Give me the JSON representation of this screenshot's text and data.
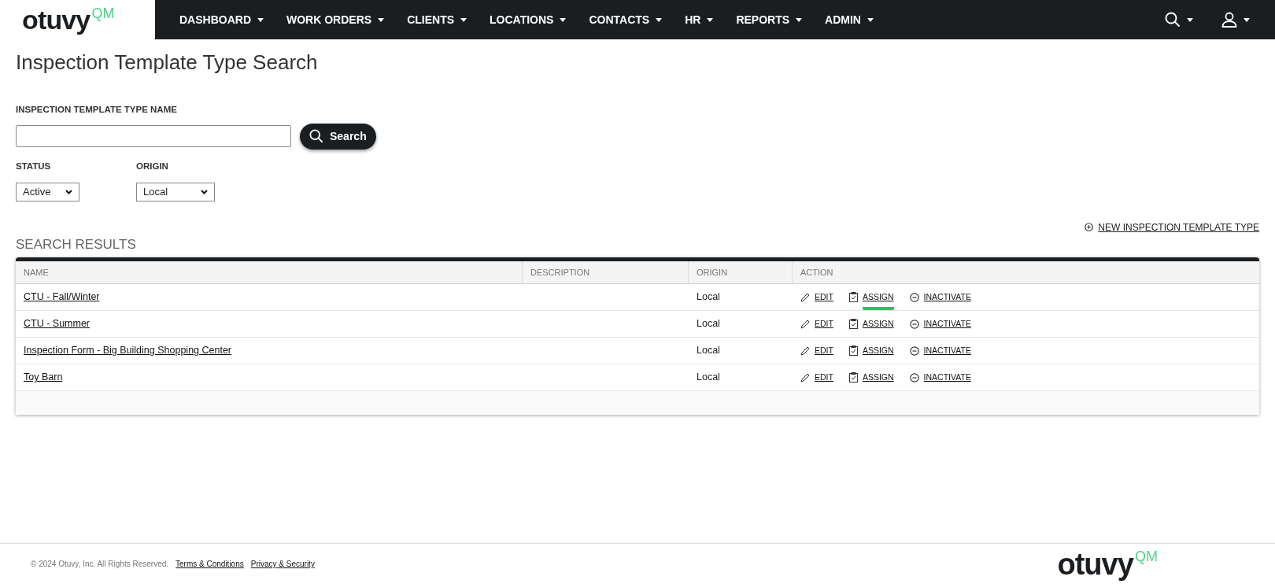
{
  "header": {
    "logo": {
      "text": "otuvy",
      "suffix": "QM"
    },
    "nav": [
      {
        "label": "DASHBOARD"
      },
      {
        "label": "WORK ORDERS"
      },
      {
        "label": "CLIENTS"
      },
      {
        "label": "LOCATIONS"
      },
      {
        "label": "CONTACTS"
      },
      {
        "label": "HR"
      },
      {
        "label": "REPORTS"
      },
      {
        "label": "ADMIN"
      }
    ]
  },
  "page_title": "Inspection Template Type Search",
  "filters": {
    "name_label": "INSPECTION TEMPLATE TYPE NAME",
    "search_button": "Search",
    "status": {
      "label": "STATUS",
      "value": "Active"
    },
    "origin": {
      "label": "ORIGIN",
      "value": "Local"
    }
  },
  "new_link": "NEW INSPECTION TEMPLATE TYPE",
  "results_title": "SEARCH RESULTS",
  "table": {
    "columns": [
      "NAME",
      "DESCRIPTION",
      "ORIGIN",
      "ACTION"
    ],
    "rows": [
      {
        "name": "CTU - Fall/Winter",
        "origin": "Local",
        "actions": [
          {
            "kind": "edit",
            "label": "EDIT",
            "highlighted": false
          },
          {
            "kind": "assign",
            "label": "ASSIGN",
            "highlighted": true
          },
          {
            "kind": "inactivate",
            "label": "INACTIVATE",
            "highlighted": false
          }
        ]
      },
      {
        "name": "CTU - Summer",
        "origin": "Local",
        "actions": [
          {
            "kind": "edit",
            "label": "EDIT",
            "highlighted": false
          },
          {
            "kind": "assign",
            "label": "ASSIGN",
            "highlighted": false
          },
          {
            "kind": "inactivate",
            "label": "INACTIVATE",
            "highlighted": false
          }
        ]
      },
      {
        "name": "Inspection Form - Big Building Shopping Center",
        "origin": "Local",
        "actions": [
          {
            "kind": "edit",
            "label": "EDIT",
            "highlighted": false
          },
          {
            "kind": "assign",
            "label": "ASSIGN",
            "highlighted": false
          },
          {
            "kind": "inactivate",
            "label": "INACTIVATE",
            "highlighted": false
          }
        ]
      },
      {
        "name": "Toy Barn",
        "origin": "Local",
        "actions": [
          {
            "kind": "edit",
            "label": "EDIT",
            "highlighted": false
          },
          {
            "kind": "assign",
            "label": "ASSIGN",
            "highlighted": false
          },
          {
            "kind": "inactivate",
            "label": "INACTIVATE",
            "highlighted": false
          }
        ]
      }
    ]
  },
  "footer": {
    "copyright": "© 2024 Otuvy, Inc. All Rights Reserved.",
    "links": [
      "Terms & Conditions",
      "Privacy & Security"
    ],
    "logo": {
      "text": "otuvy",
      "suffix": "QM"
    }
  }
}
